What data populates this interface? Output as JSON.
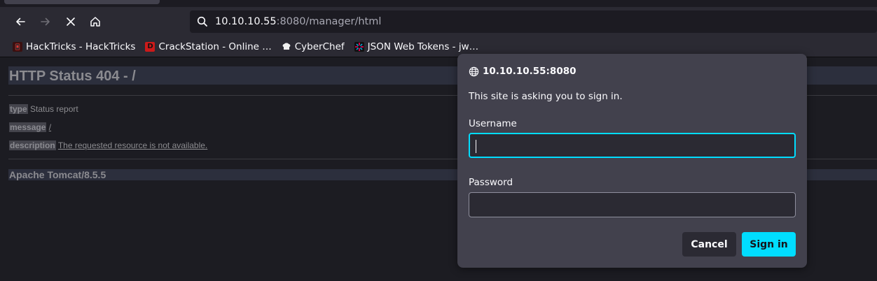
{
  "browser": {
    "address": {
      "host": "10.10.10.55",
      "path": ":8080/manager/html"
    },
    "bookmarks": [
      {
        "label": "HackTricks - HackTricks",
        "icon": "hacktricks-icon"
      },
      {
        "label": "CrackStation - Online …",
        "icon": "crackstation-icon"
      },
      {
        "label": "CyberChef",
        "icon": "cyberchef-icon"
      },
      {
        "label": "JSON Web Tokens - jw…",
        "icon": "jwt-icon"
      }
    ]
  },
  "page": {
    "title": "HTTP Status 404 - /",
    "type_label": "type",
    "type_value": "Status report",
    "message_label": "message",
    "message_value": "/",
    "description_label": "description",
    "description_value": "The requested resource is not available.",
    "footer": "Apache Tomcat/8.5.5"
  },
  "dialog": {
    "host": "10.10.10.55:8080",
    "message": "This site is asking you to sign in.",
    "username_label": "Username",
    "username_value": "",
    "password_label": "Password",
    "password_value": "",
    "cancel_label": "Cancel",
    "signin_label": "Sign in"
  },
  "colors": {
    "accent": "#00ddff",
    "dialog_bg": "#42414d",
    "toolbar_bg": "#2b2a33"
  }
}
